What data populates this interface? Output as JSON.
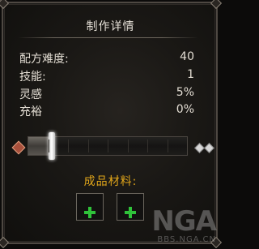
{
  "panel": {
    "title": "制作详情",
    "stats": [
      {
        "label": "配方难度:",
        "value": "40"
      },
      {
        "label": "技能:",
        "value": "1"
      },
      {
        "label": "灵感",
        "value": "5%"
      },
      {
        "label": "充裕",
        "value": "0%"
      }
    ]
  },
  "slider": {
    "segments": 8,
    "position_fraction": 0.15
  },
  "materials": {
    "title": "成品材料:",
    "slots": [
      {
        "icon": "plus-icon"
      },
      {
        "icon": "plus-icon"
      }
    ]
  },
  "watermark": {
    "logo": "NGA",
    "url": "BBS.NGA.CN"
  },
  "colors": {
    "title_text": "#e6e1d8",
    "materials_title": "#e0a51a",
    "plus_icon": "#2fc23a",
    "left_selector": "#a8503c",
    "right_selector": "#d7d7d7"
  }
}
